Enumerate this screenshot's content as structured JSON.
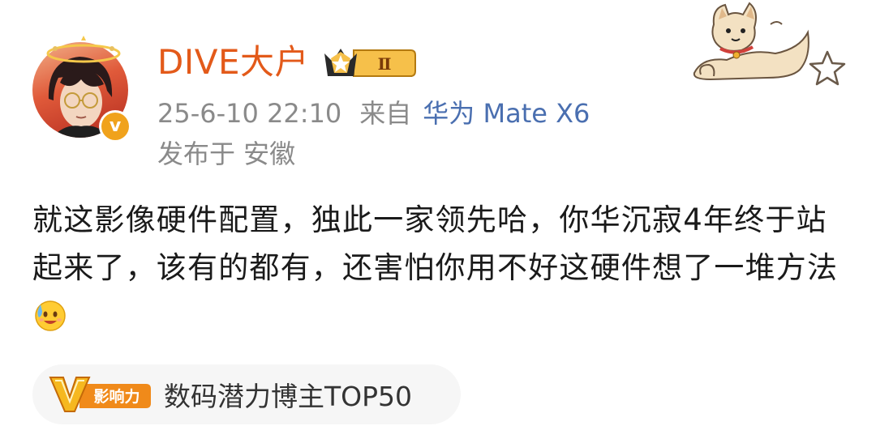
{
  "user": {
    "name": "DIVE大户",
    "rank_numeral": "Ⅱ",
    "verified_mark": "v"
  },
  "meta": {
    "time": "25-6-10 22:10",
    "from_label": "来自",
    "device": "华为 Mate X6",
    "location": "发布于 安徽"
  },
  "post": {
    "text": "就这影像硬件配置，独此一家领先哈，你华沉寂4年终于站起来了，该有的都有，还害怕你用不好这硬件想了一堆方法"
  },
  "influence": {
    "badge_letter": "V",
    "badge_label": "影响力",
    "text": "数码潜力博主TOP50"
  },
  "colors": {
    "username": "#e35a1a",
    "device_link": "#4a6fb0",
    "meta_gray": "#8a8a8a",
    "verified": "#f0a21c"
  },
  "icons": [
    "avatar",
    "verified-icon",
    "crown-icon",
    "dog-sticker",
    "star-icon",
    "sweat-smile-emoji",
    "influence-v-icon"
  ]
}
